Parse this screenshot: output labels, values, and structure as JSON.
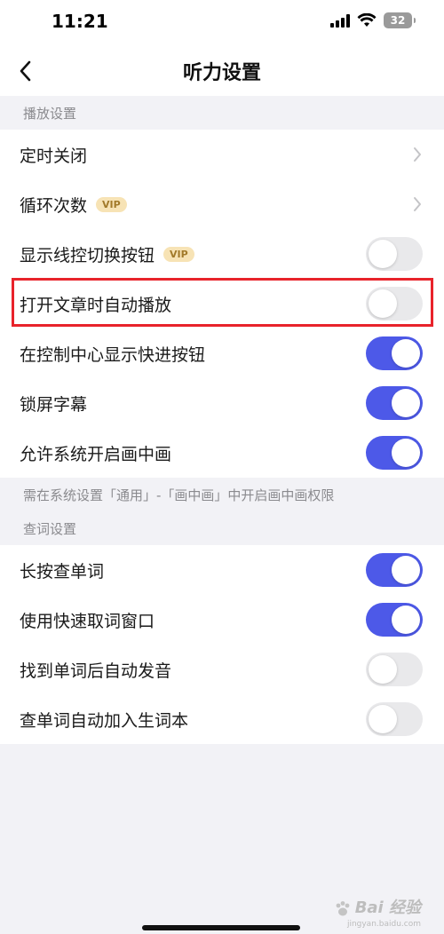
{
  "status_bar": {
    "time": "11:21",
    "battery": "32"
  },
  "nav": {
    "title": "听力设置"
  },
  "playback_section": {
    "header": "播放设置",
    "note": "需在系统设置「通用」-「画中画」中开启画中画权限",
    "items": [
      {
        "label": "定时关闭",
        "type": "link"
      },
      {
        "label": "循环次数",
        "type": "link",
        "badge": "VIP"
      },
      {
        "label": "显示线控切换按钮",
        "type": "toggle",
        "badge": "VIP",
        "on": false
      },
      {
        "label": "打开文章时自动播放",
        "type": "toggle",
        "on": false
      },
      {
        "label": "在控制中心显示快进按钮",
        "type": "toggle",
        "on": true
      },
      {
        "label": "锁屏字幕",
        "type": "toggle",
        "on": true
      },
      {
        "label": "允许系统开启画中画",
        "type": "toggle",
        "on": true
      }
    ]
  },
  "lookup_section": {
    "header": "查词设置",
    "items": [
      {
        "label": "长按查单词",
        "type": "toggle",
        "on": true
      },
      {
        "label": "使用快速取词窗口",
        "type": "toggle",
        "on": true
      },
      {
        "label": "找到单词后自动发音",
        "type": "toggle",
        "on": false
      },
      {
        "label": "查单词自动加入生词本",
        "type": "toggle",
        "on": false
      }
    ]
  },
  "watermark": {
    "logo": "Bai 经验",
    "url": "jingyan.baidu.com"
  },
  "colors": {
    "toggle_on": "#4d59e8",
    "toggle_off": "#e9e9eb",
    "highlight": "#e8232b",
    "vip_bg": "#f7e3b5",
    "vip_text": "#a27a2a"
  }
}
